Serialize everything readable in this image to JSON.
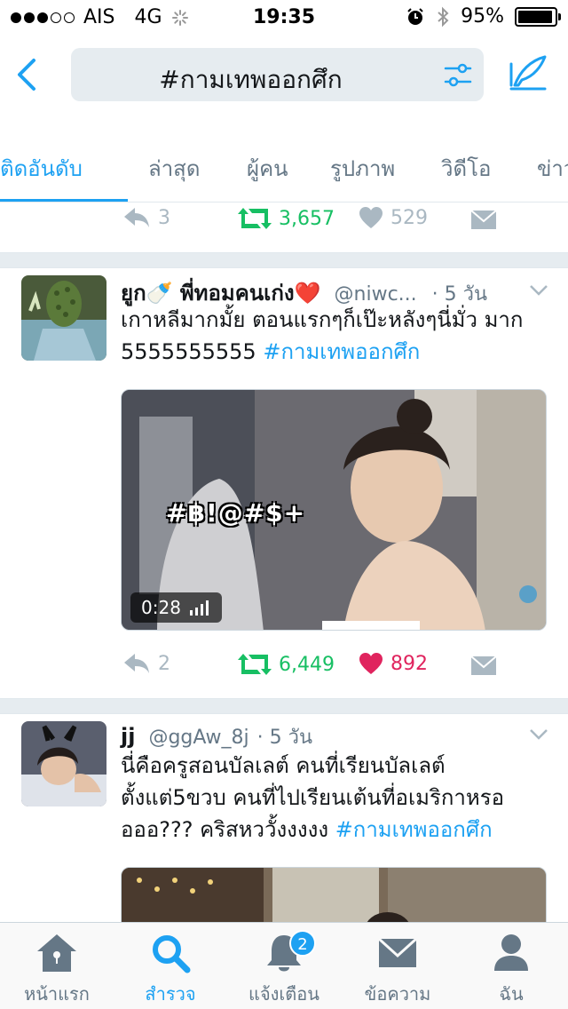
{
  "status_bar": {
    "carrier": "AIS",
    "network": "4G",
    "time": "19:35",
    "battery": "95%",
    "battery_level": 0.95
  },
  "header": {
    "search_query": "#กามเทพออกศึก",
    "icons": [
      "back-icon",
      "filter-icon",
      "compose-icon"
    ],
    "accent_color": "#1da1f2"
  },
  "tabs": [
    {
      "label": "ติดอันดับ",
      "active": true
    },
    {
      "label": "ล่าสุด",
      "active": false
    },
    {
      "label": "ผู้คน",
      "active": false
    },
    {
      "label": "รูปภาพ",
      "active": false
    },
    {
      "label": "วิดีโอ",
      "active": false
    },
    {
      "label": "ข่าว",
      "active": false
    }
  ],
  "prev_tweet_actions": {
    "reply_count": "3",
    "retweet_count": "3,657",
    "like_count": "529"
  },
  "tweets": [
    {
      "name": "ยูก🍼 พี่ทอมคนเก่ง❤️",
      "handle": "@niwc...",
      "time": "· 5 วัน",
      "text": "เกาหลีมากมั้ย ตอนแรกๆก็เป๊ะหลังๆนี่มั่ว มาก 5555555555 ",
      "hashtag": "#กามเทพออกศึก",
      "media_caption": "#฿!@#$+",
      "video_duration": "0:28",
      "reply_count": "2",
      "retweet_count": "6,449",
      "like_count": "892",
      "liked": true
    },
    {
      "name": "jj",
      "handle": "@ggAw_8j",
      "time": "· 5 วัน",
      "text": "นี่คือครูสอนบัลเลต์ คนที่เรียนบัลเลต์ ตั้งแต่5ขวบ คนที่ไปเรียนเต้นที่อเมริกาหรอ อออ??? คริสหววั้งงงงง ",
      "hashtag": "#กามเทพออกศึก"
    }
  ],
  "bottom_nav": [
    {
      "label": "หน้าแรก",
      "icon": "home-icon",
      "active": false
    },
    {
      "label": "สำรวจ",
      "icon": "search-icon",
      "active": true
    },
    {
      "label": "แจ้งเตือน",
      "icon": "bell-icon",
      "active": false,
      "badge": "2"
    },
    {
      "label": "ข้อความ",
      "icon": "envelope-icon",
      "active": false
    },
    {
      "label": "ฉัน",
      "icon": "person-icon",
      "active": false
    }
  ]
}
